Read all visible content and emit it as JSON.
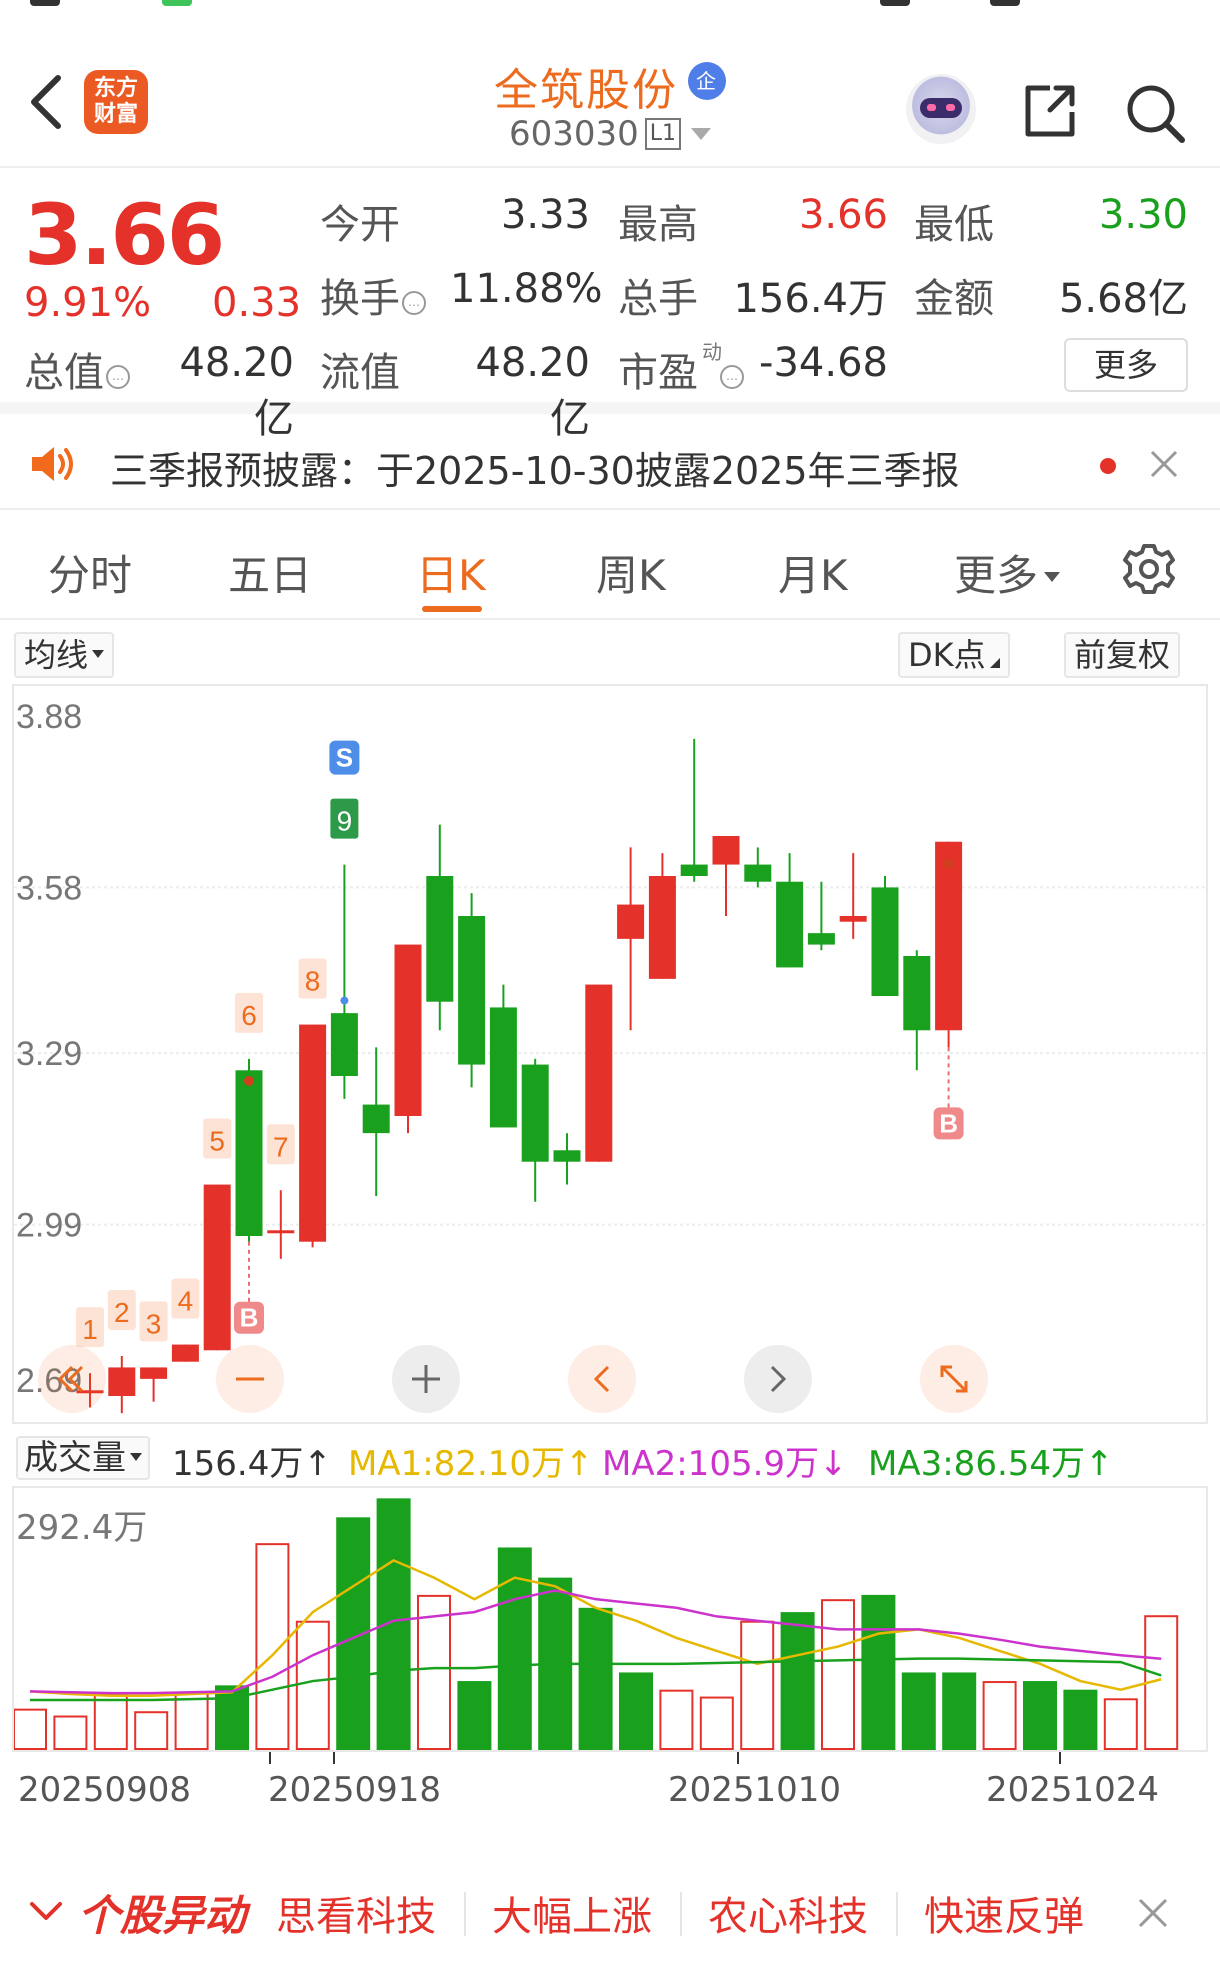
{
  "header": {
    "brand_logo_text": "东方财富",
    "stock_name": "全筑股份",
    "badge": "企",
    "stock_code": "603030",
    "level_badge": "L1",
    "brand_color": "#ec6b1e"
  },
  "quote": {
    "price": "3.66",
    "change_pct": "9.91%",
    "change_amt": "0.33",
    "open_label": "今开",
    "open_value": "3.33",
    "high_label": "最高",
    "high_value": "3.66",
    "low_label": "最低",
    "low_value": "3.30",
    "turnover_label": "换手",
    "turnover_value": "11.88%",
    "volume_label": "总手",
    "volume_value": "156.4万",
    "amount_label": "金额",
    "amount_value": "5.68亿",
    "mktcap_label": "总值",
    "mktcap_value": "48.20亿",
    "float_label": "流值",
    "float_value": "48.20亿",
    "pe_label": "市盈",
    "pe_sup": "动",
    "pe_value": "-34.68",
    "more_label": "更多",
    "up_color": "#e4322b",
    "down_color": "#19a11e"
  },
  "notice": {
    "text": "三季报预披露：于2025-10-30披露2025年三季报"
  },
  "tabs": [
    {
      "label": "分时"
    },
    {
      "label": "五日"
    },
    {
      "label": "日K"
    },
    {
      "label": "周K"
    },
    {
      "label": "月K"
    },
    {
      "label": "更多"
    }
  ],
  "active_tab": "日K",
  "toolbar": {
    "ma_select": "均线",
    "dk_points": "DK点",
    "adjust": "前复权"
  },
  "volume_panel": {
    "select_label": "成交量",
    "vol_text": "156.4万↑",
    "ma1_text": "MA1:82.10万↑",
    "ma2_text": "MA2:105.9万↓",
    "ma3_text": "MA3:86.54万↑",
    "max_label": "292.4万",
    "ma1_color": "#e6b800",
    "ma2_color": "#cc33cc",
    "ma3_color": "#19a11e"
  },
  "ticker": {
    "title": "个股异动",
    "items": [
      "思看科技",
      "大幅上涨",
      "农心科技",
      "快速反弹"
    ]
  },
  "chart_data": {
    "type": "candlestick",
    "y_ticks": [
      "3.88",
      "3.58",
      "3.29",
      "2.99",
      "2.69"
    ],
    "ylim": [
      2.69,
      3.88
    ],
    "x_tick_labels": [
      "20250908",
      "20250918",
      "20251010",
      "20251024"
    ],
    "candles": [
      {
        "o": 2.7,
        "h": 2.73,
        "l": 2.67,
        "c": 2.7
      },
      {
        "o": 2.69,
        "h": 2.76,
        "l": 2.66,
        "c": 2.74
      },
      {
        "o": 2.72,
        "h": 2.74,
        "l": 2.68,
        "c": 2.74
      },
      {
        "o": 2.75,
        "h": 2.78,
        "l": 2.75,
        "c": 2.78
      },
      {
        "o": 2.77,
        "h": 3.06,
        "l": 2.77,
        "c": 3.06
      },
      {
        "o": 3.26,
        "h": 3.28,
        "l": 2.96,
        "c": 2.97
      },
      {
        "o": 2.98,
        "h": 3.05,
        "l": 2.93,
        "c": 2.98
      },
      {
        "o": 2.96,
        "h": 3.34,
        "l": 2.95,
        "c": 3.34
      },
      {
        "o": 3.36,
        "h": 3.62,
        "l": 3.21,
        "c": 3.25
      },
      {
        "o": 3.2,
        "h": 3.3,
        "l": 3.04,
        "c": 3.15
      },
      {
        "o": 3.18,
        "h": 3.48,
        "l": 3.15,
        "c": 3.48
      },
      {
        "o": 3.6,
        "h": 3.69,
        "l": 3.33,
        "c": 3.38
      },
      {
        "o": 3.53,
        "h": 3.57,
        "l": 3.23,
        "c": 3.27
      },
      {
        "o": 3.37,
        "h": 3.41,
        "l": 3.16,
        "c": 3.16
      },
      {
        "o": 3.27,
        "h": 3.28,
        "l": 3.03,
        "c": 3.1
      },
      {
        "o": 3.12,
        "h": 3.15,
        "l": 3.06,
        "c": 3.1
      },
      {
        "o": 3.1,
        "h": 3.41,
        "l": 3.1,
        "c": 3.41
      },
      {
        "o": 3.49,
        "h": 3.65,
        "l": 3.33,
        "c": 3.55
      },
      {
        "o": 3.42,
        "h": 3.64,
        "l": 3.42,
        "c": 3.6
      },
      {
        "o": 3.62,
        "h": 3.84,
        "l": 3.59,
        "c": 3.6
      },
      {
        "o": 3.62,
        "h": 3.67,
        "l": 3.53,
        "c": 3.67
      },
      {
        "o": 3.62,
        "h": 3.65,
        "l": 3.58,
        "c": 3.59
      },
      {
        "o": 3.59,
        "h": 3.64,
        "l": 3.44,
        "c": 3.44
      },
      {
        "o": 3.5,
        "h": 3.59,
        "l": 3.47,
        "c": 3.48
      },
      {
        "o": 3.52,
        "h": 3.64,
        "l": 3.49,
        "c": 3.53
      },
      {
        "o": 3.58,
        "h": 3.6,
        "l": 3.39,
        "c": 3.39
      },
      {
        "o": 3.46,
        "h": 3.47,
        "l": 3.26,
        "c": 3.33
      },
      {
        "o": 3.33,
        "h": 3.66,
        "l": 3.3,
        "c": 3.66
      }
    ],
    "markers": [
      {
        "label": "1",
        "bar": 1
      },
      {
        "label": "2",
        "bar": 2
      },
      {
        "label": "3",
        "bar": 3
      },
      {
        "label": "4",
        "bar": 4
      },
      {
        "label": "5",
        "bar": 5
      },
      {
        "label": "6",
        "bar": 6
      },
      {
        "label": "7",
        "bar": 7
      },
      {
        "label": "8",
        "bar": 8
      },
      {
        "label": "9",
        "bar": 9
      }
    ],
    "signals": [
      {
        "label": "S",
        "bar": 9
      },
      {
        "label": "B",
        "bar": 6
      },
      {
        "label": "B",
        "bar": 28
      }
    ],
    "volume": {
      "max": 292.4,
      "bars": [
        48,
        40,
        65,
        45,
        67,
        75,
        240,
        150,
        270,
        292,
        180,
        80,
        235,
        200,
        165,
        90,
        70,
        62,
        150,
        160,
        175,
        180,
        90,
        90,
        80,
        80,
        70,
        60,
        156.4
      ],
      "ma1": [
        68,
        65,
        63,
        63,
        65,
        67,
        110,
        160,
        190,
        220,
        200,
        175,
        200,
        190,
        165,
        150,
        130,
        115,
        100,
        110,
        120,
        135,
        140,
        130,
        115,
        100,
        80,
        70,
        82.1
      ],
      "ma2": [
        68,
        67,
        66,
        66,
        67,
        68,
        85,
        110,
        130,
        150,
        155,
        160,
        175,
        185,
        175,
        170,
        165,
        155,
        150,
        145,
        140,
        140,
        140,
        135,
        128,
        120,
        115,
        110,
        105.9
      ],
      "ma3": [
        58,
        58,
        58,
        58,
        59,
        60,
        70,
        80,
        85,
        92,
        95,
        95,
        98,
        100,
        100,
        100,
        100,
        101,
        102,
        103,
        104,
        105,
        106,
        106,
        105,
        104,
        103,
        102,
        86.54
      ]
    }
  }
}
